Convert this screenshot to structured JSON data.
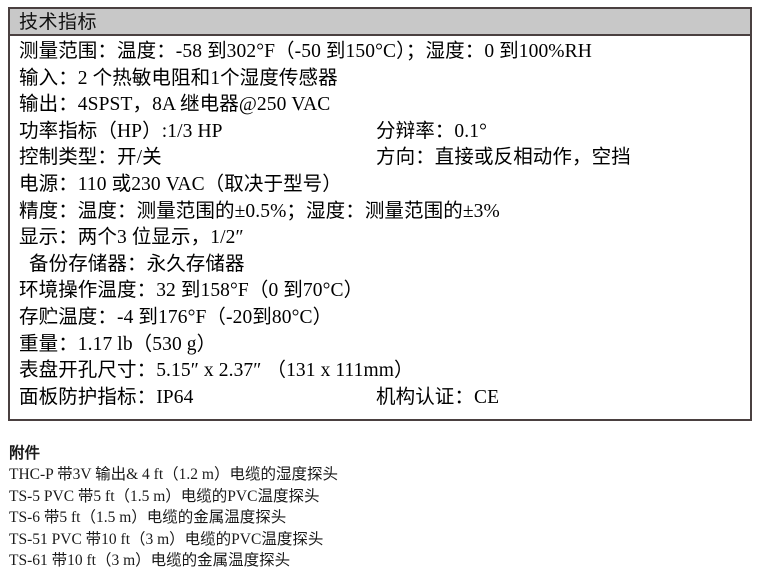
{
  "spec_table": {
    "header_title": "技术指标",
    "rows": [
      {
        "type": "single",
        "text": "测量范围：温度：-58 到302°F（-50 到150°C）；湿度：0 到100%RH"
      },
      {
        "type": "single",
        "text": "输入：2 个热敏电阻和1个湿度传感器"
      },
      {
        "type": "single",
        "text": "输出：4SPST，8A 继电器@250 VAC"
      },
      {
        "type": "two-col",
        "left": "功率指标（HP）:1/3 HP",
        "right": "分辩率：0.1°"
      },
      {
        "type": "two-col",
        "left": "控制类型：开/关",
        "right": "方向：直接或反相动作，空挡"
      },
      {
        "type": "single",
        "text": "电源：110 或230 VAC（取决于型号）"
      },
      {
        "type": "single",
        "text": "精度：温度：测量范围的±0.5%；湿度：测量范围的±3%"
      },
      {
        "type": "single",
        "text": "显示：两个3 位显示，1/2″"
      },
      {
        "type": "indent",
        "text": "备份存储器：永久存储器"
      },
      {
        "type": "single",
        "text": "环境操作温度：32 到158°F（0 到70°C）"
      },
      {
        "type": "single",
        "text": "存贮温度：-4 到176°F（-20到80°C）"
      },
      {
        "type": "single",
        "text": "重量：1.17 lb（530 g）"
      },
      {
        "type": "single",
        "text": "表盘开孔尺寸：5.15″ x 2.37″ （131 x 111mm）"
      },
      {
        "type": "two-col",
        "left": "面板防护指标：IP64",
        "right": "机构认证：CE"
      }
    ]
  },
  "accessories": {
    "title": "附件",
    "items": [
      "THC-P 带3V 输出& 4 ft（1.2 m）电缆的湿度探头",
      "TS-5 PVC 带5 ft（1.5 m）电缆的PVC温度探头",
      "TS-6 带5 ft（1.5 m）电缆的金属温度探头",
      "TS-51 PVC 带10 ft（3 m）电缆的PVC温度探头",
      "TS-61 带10 ft（3 m）电缆的金属温度探头"
    ]
  },
  "colors": {
    "header_background": "#c8c8c8",
    "border": "#4a4040",
    "text": "#000000",
    "page_background": "#ffffff"
  }
}
